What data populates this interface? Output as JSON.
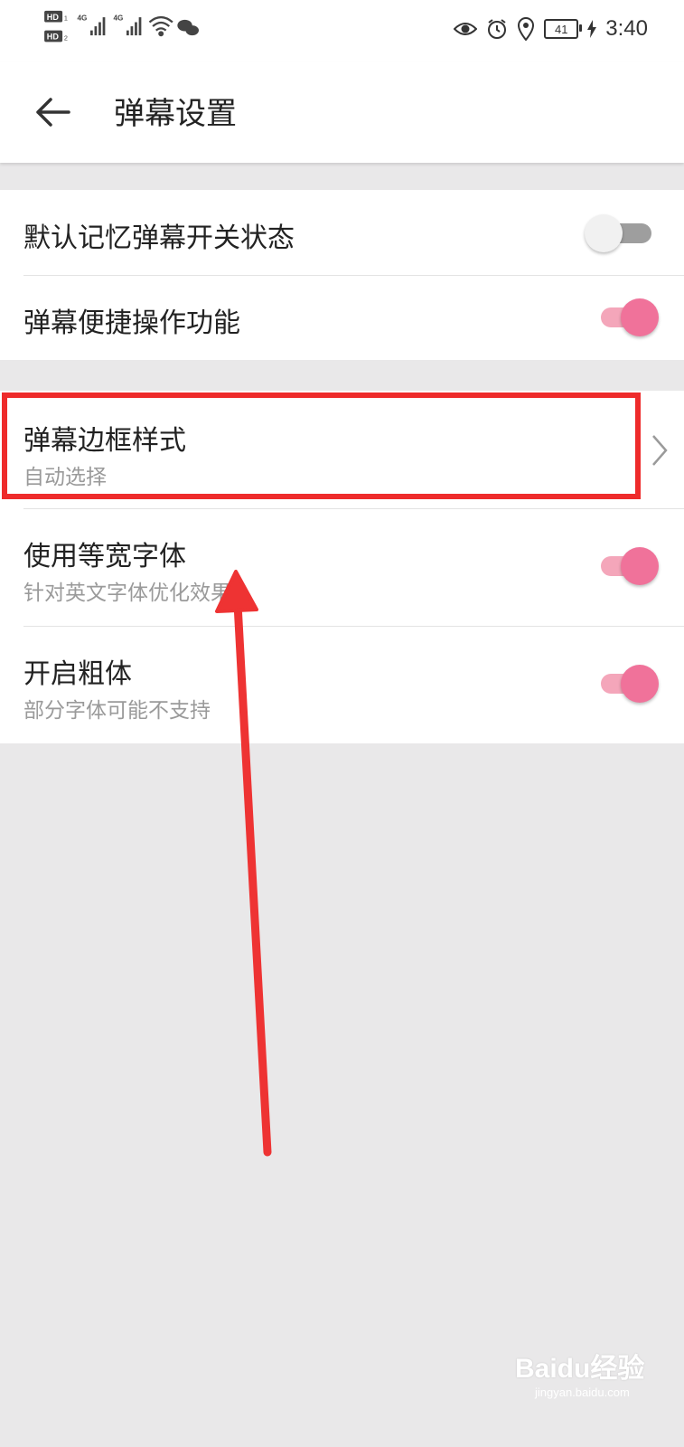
{
  "status_bar": {
    "time": "3:40",
    "battery": "41",
    "sim1_badge": "HD",
    "sim2_badge": "HD",
    "network1": "4G",
    "network2": "4G",
    "icons": [
      "hd-sim1-icon",
      "hd-sim2-icon",
      "signal-4g-icon",
      "signal-4g-icon",
      "wifi-icon",
      "wechat-icon",
      "eye-icon",
      "alarm-icon",
      "location-icon",
      "battery-icon",
      "charging-icon"
    ]
  },
  "app_bar": {
    "title": "弹幕设置",
    "back_icon": "arrow-left-icon"
  },
  "settings": {
    "remember_state": {
      "label": "默认记忆弹幕开关状态",
      "enabled": false
    },
    "quick_ops": {
      "label": "弹幕便捷操作功能",
      "enabled": true
    },
    "border_style": {
      "label": "弹幕边框样式",
      "value": "自动选择"
    },
    "monospace": {
      "label": "使用等宽字体",
      "desc": "针对英文字体优化效果",
      "enabled": true
    },
    "bold": {
      "label": "开启粗体",
      "desc": "部分字体可能不支持",
      "enabled": true
    }
  },
  "colors": {
    "accent": "#f0729a",
    "accent_track": "#f4a6ba",
    "highlight": "#ee2b2b",
    "background": "#e9e8e9"
  },
  "watermark": {
    "text": "Baidu经验",
    "url": "jingyan.baidu.com"
  }
}
